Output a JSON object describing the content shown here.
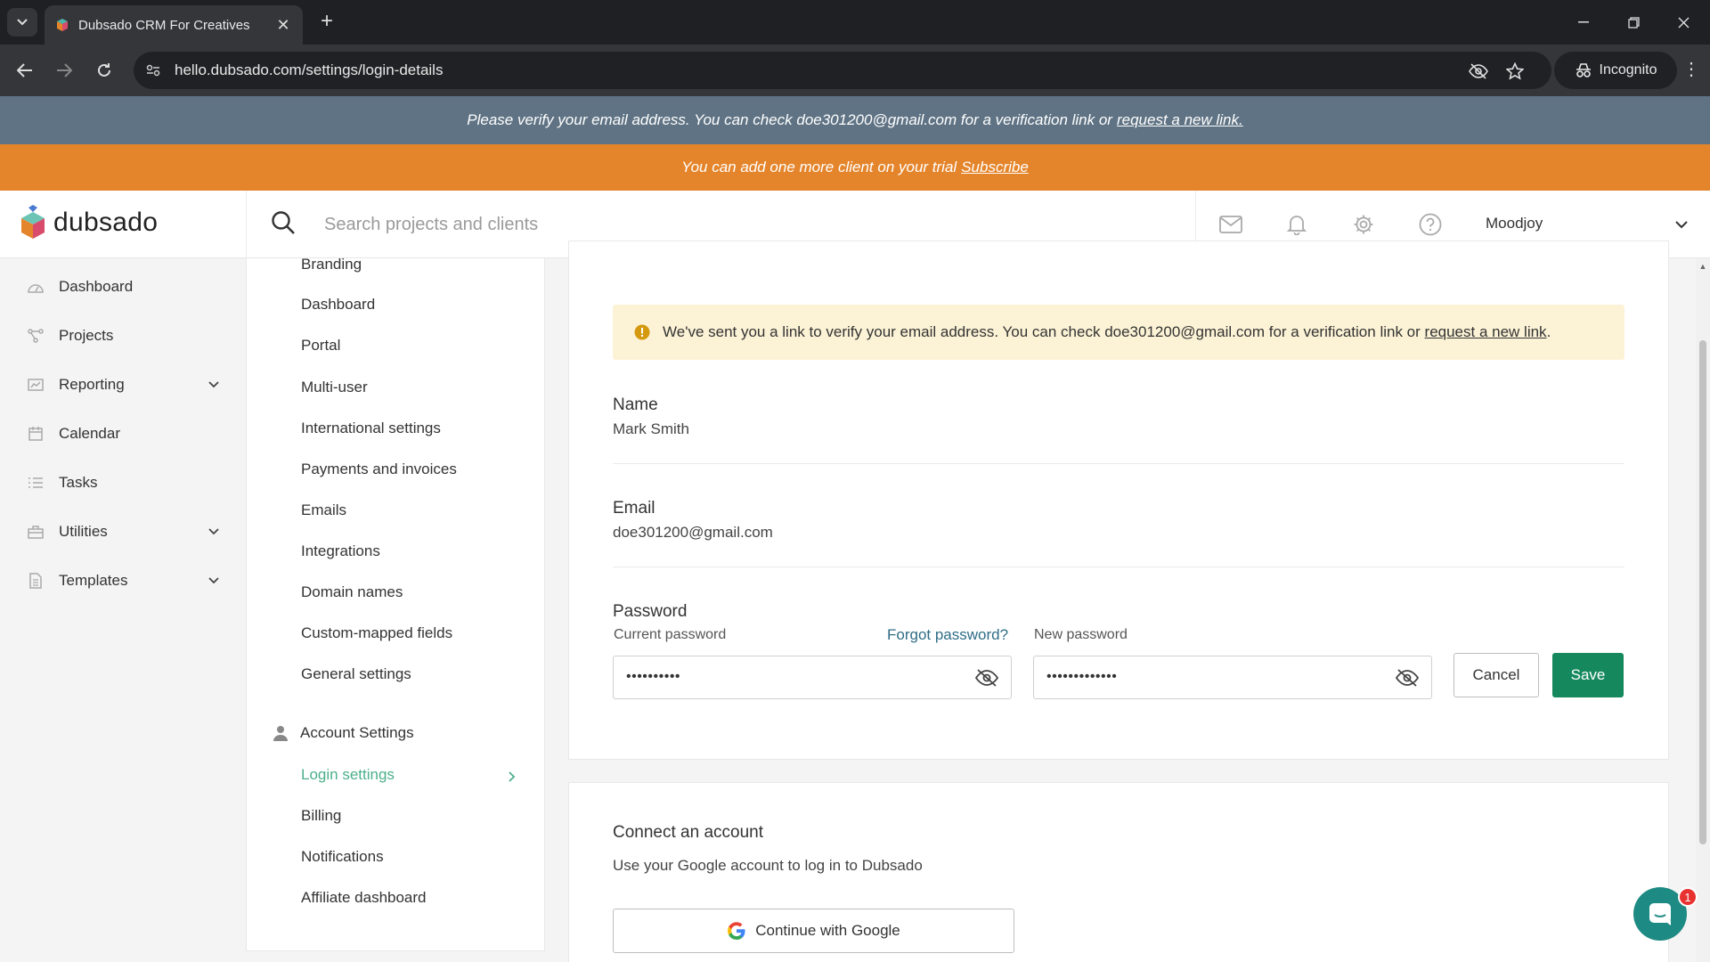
{
  "browser": {
    "tab_title": "Dubsado CRM For Creatives",
    "url": "hello.dubsado.com/settings/login-details",
    "incognito_label": "Incognito"
  },
  "banners": {
    "verify_text": "Please verify your email address. You can check doe301200@gmail.com for a verification link or",
    "verify_link": "request a new link.",
    "trial_text": "You can add one more client on your trial",
    "trial_link": "Subscribe"
  },
  "header": {
    "logo_text": "dubsado",
    "search_placeholder": "Search projects and clients",
    "user_name": "Moodjoy"
  },
  "sidebar": {
    "items": [
      {
        "label": "Dashboard",
        "icon": "dashboard-icon"
      },
      {
        "label": "Projects",
        "icon": "projects-icon"
      },
      {
        "label": "Reporting",
        "icon": "reporting-icon"
      },
      {
        "label": "Calendar",
        "icon": "calendar-icon"
      },
      {
        "label": "Tasks",
        "icon": "tasks-icon"
      },
      {
        "label": "Utilities",
        "icon": "utilities-icon"
      },
      {
        "label": "Templates",
        "icon": "templates-icon"
      }
    ]
  },
  "settings_nav": {
    "items": [
      "Branding",
      "Dashboard",
      "Portal",
      "Multi-user",
      "International settings",
      "Payments and invoices",
      "Emails",
      "Integrations",
      "Domain names",
      "Custom-mapped fields",
      "General settings"
    ],
    "account_section": "Account Settings",
    "account_items": [
      "Login settings",
      "Billing",
      "Notifications",
      "Affiliate dashboard"
    ]
  },
  "main": {
    "alert_text": "We've sent you a link to verify your email address. You can check doe301200@gmail.com for a verification link or",
    "alert_link": "request a new link",
    "alert_tail": ".",
    "name_label": "Name",
    "name_value": "Mark Smith",
    "email_label": "Email",
    "email_value": "doe301200@gmail.com",
    "password_label": "Password",
    "current_password_label": "Current password",
    "forgot_password": "Forgot password?",
    "new_password_label": "New password",
    "current_password_value": "••••••••••",
    "new_password_value": "•••••••••••••",
    "cancel_label": "Cancel",
    "save_label": "Save",
    "connect_title": "Connect an account",
    "connect_desc": "Use your Google account to log in to Dubsado",
    "google_button": "Continue with Google"
  },
  "chat": {
    "badge_count": "1"
  },
  "colors": {
    "accent_green": "#15895d",
    "active_nav": "#4cb08b",
    "trial_orange": "#e5852b",
    "verify_slate": "#5f7384"
  }
}
